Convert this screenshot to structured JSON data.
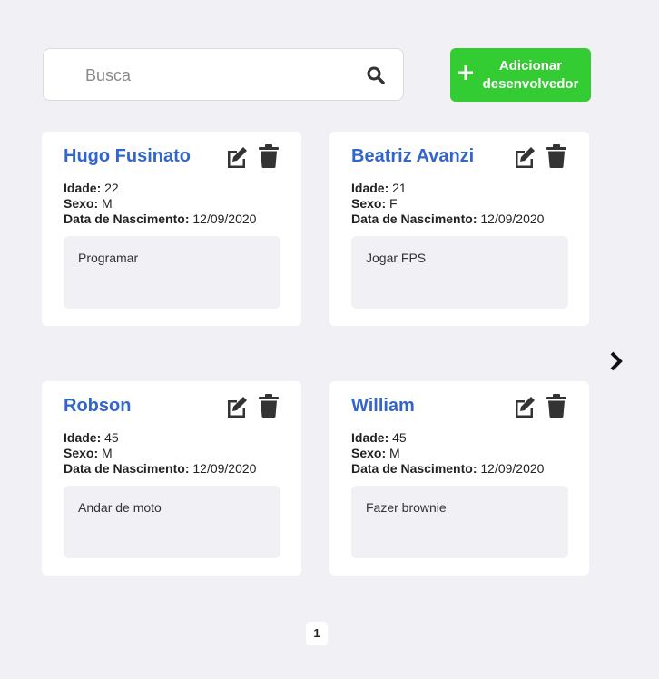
{
  "search": {
    "placeholder": "Busca",
    "value": "",
    "icon": "search-icon"
  },
  "add_button": {
    "label": "Adicionar desenvolvedor",
    "icon": "plus-icon",
    "color": "#33cc33"
  },
  "labels": {
    "age": "Idade:",
    "sex": "Sexo:",
    "birth": "Data de Nascimento:"
  },
  "developers": [
    {
      "name": "Hugo Fusinato",
      "age": "22",
      "sex": "M",
      "birth": "12/09/2020",
      "hobby": "Programar"
    },
    {
      "name": "Beatriz Avanzi",
      "age": "21",
      "sex": "F",
      "birth": "12/09/2020",
      "hobby": "Jogar FPS"
    },
    {
      "name": "Robson",
      "age": "45",
      "sex": "M",
      "birth": "12/09/2020",
      "hobby": "Andar de moto"
    },
    {
      "name": "William",
      "age": "45",
      "sex": "M",
      "birth": "12/09/2020",
      "hobby": "Fazer brownie"
    }
  ],
  "pagination": {
    "current_page": "1"
  },
  "colors": {
    "name": "#3366cc",
    "background": "#f0f0f5"
  }
}
